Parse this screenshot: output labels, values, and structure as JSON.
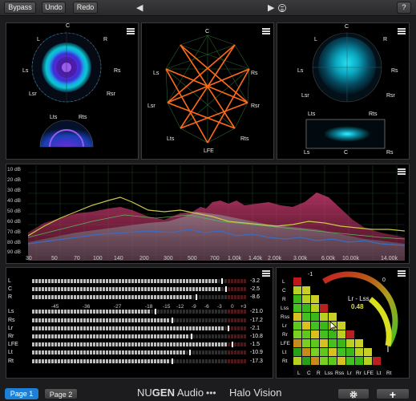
{
  "toolbar": {
    "bypass": "Bypass",
    "undo": "Undo",
    "redo": "Redo",
    "prev_glyph": "◀",
    "next_glyph": "▶",
    "help": "?"
  },
  "channels_7_1_4": {
    "L": "L",
    "C": "C",
    "R": "R",
    "Ls": "Ls",
    "Rs": "Rs",
    "Lsr": "Lsr",
    "Rsr": "Rsr",
    "Lts": "Lts",
    "Rts": "Rts",
    "LFE": "LFE"
  },
  "spectrum": {
    "y_ticks": [
      "10 dB",
      "20 dB",
      "30 dB",
      "40 dB",
      "50 dB",
      "60 dB",
      "70 dB",
      "80 dB",
      "90 dB"
    ],
    "x_ticks": [
      "30",
      "50",
      "70",
      "100",
      "140",
      "200",
      "300",
      "500",
      "700",
      "1.00k",
      "1.40k",
      "2.00k",
      "3.00k",
      "6.00k",
      "10.00k",
      "14.00k"
    ]
  },
  "meters": {
    "top_rows": [
      {
        "label": "L",
        "value": "-3.2"
      },
      {
        "label": "C",
        "value": "-2.5"
      },
      {
        "label": "R",
        "value": "-8.6"
      }
    ],
    "scale": [
      "-45",
      "-36",
      "-27",
      "-18",
      "-15",
      "-12",
      "-9",
      "-6",
      "-3",
      "0",
      "+3"
    ],
    "bottom_rows": [
      {
        "label": "Ls",
        "value": "-21.0"
      },
      {
        "label": "Rs",
        "value": "-17.2"
      },
      {
        "label": "Lr",
        "value": "-2.1"
      },
      {
        "label": "Rr",
        "value": "-10.8"
      },
      {
        "label": "LFE",
        "value": "-1.5"
      },
      {
        "label": "Lt",
        "value": "-10.9"
      },
      {
        "label": "Rt",
        "value": "-17.3"
      }
    ]
  },
  "correlation": {
    "minus_label": "-1",
    "zero_label": "0",
    "pair_label": "Lr - Lss",
    "pair_value": "0.48",
    "row_labels": [
      "L",
      "C",
      "R",
      "Lss",
      "Rss",
      "Lr",
      "Rr",
      "LFE",
      "Lt",
      "Rt"
    ],
    "col_labels": [
      "L",
      "C",
      "R",
      "Lss",
      "Rss",
      "Lr",
      "Rr",
      "LFE",
      "Lt",
      "Rt"
    ]
  },
  "footer": {
    "page1": "Page 1",
    "page2": "Page 2",
    "brand_nu": "NU",
    "brand_gen": "GEN",
    "brand_audio": "Audio",
    "brand_dots": "•••",
    "product": "Halo Vision"
  },
  "colors": {
    "accent_blue": "#1e7fd6",
    "spectrum_pink": "#d0406c",
    "spectrum_yellow": "#c9c84a",
    "spectrum_blue": "#3b6cc2",
    "graph_orange": "#ff6a1a"
  }
}
